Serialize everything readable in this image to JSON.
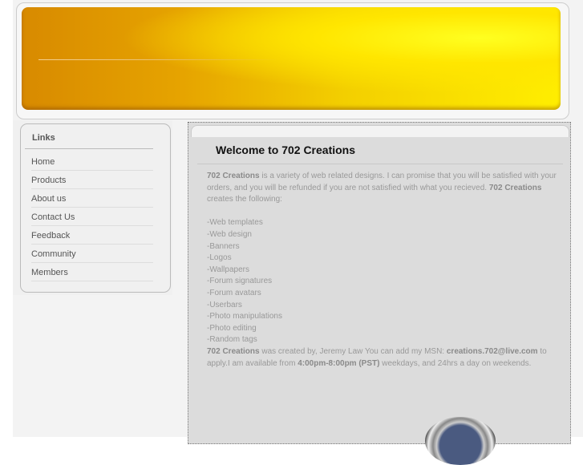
{
  "sidebar": {
    "title": "Links",
    "items": [
      "Home",
      "Products",
      "About us",
      "Contact Us",
      "Feedback",
      "Community",
      "Members"
    ]
  },
  "main": {
    "title": "Welcome to 702 Creations",
    "brand": "702 Creations",
    "intro1": " is a variety of web related designs. I can promise that you will be satisfied with your orders, and you will be refunded if you are not satisfied with what you recieved. ",
    "intro2": " creates the following:",
    "list": [
      "-Web templates",
      "-Web design",
      "-Banners",
      "-Logos",
      "-Wallpapers",
      "-Forum signatures",
      "-Forum avatars",
      "-Userbars",
      "-Photo manipulations",
      "-Photo editing",
      "-Random tags"
    ],
    "outro1": " was created by, Jeremy Law  You can add my MSN: ",
    "msn": "creations.702@live.com",
    "outro2": " to apply.I am available from ",
    "hours": "4:00pm-8:00pm (PST)",
    "outro3": " weekdays, and 24hrs a day on weekends."
  }
}
